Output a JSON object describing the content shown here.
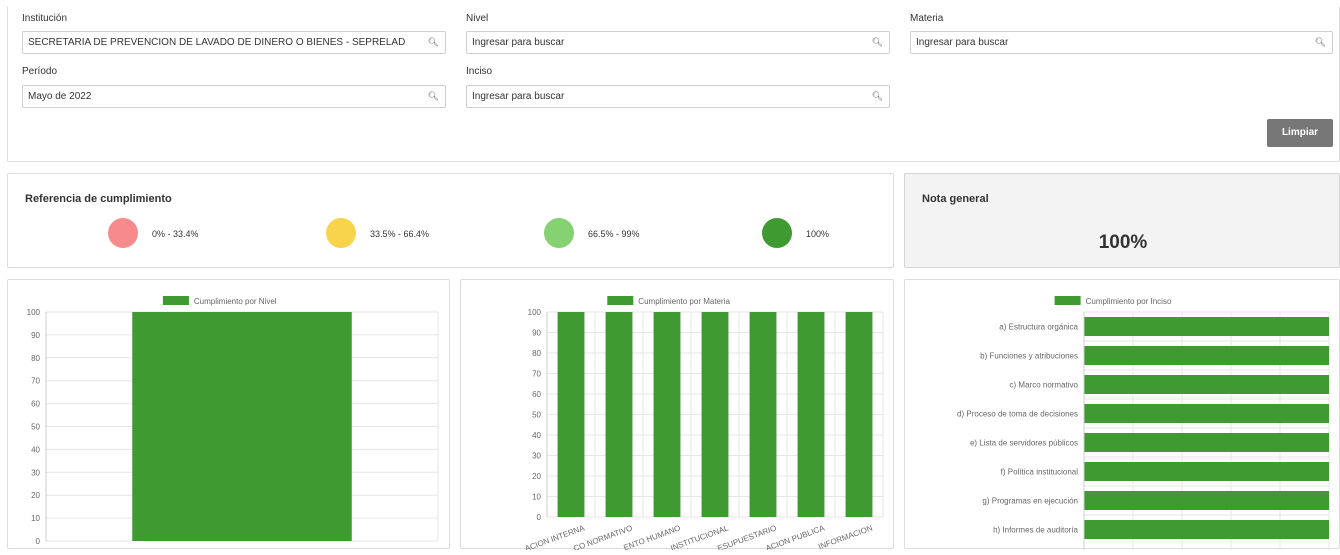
{
  "filters": {
    "institucion": {
      "label": "Institución",
      "value": "SECRETARIA DE PREVENCION DE LAVADO DE DINERO O BIENES - SEPRELAD"
    },
    "nivel": {
      "label": "Nivel",
      "placeholder": "Ingresar para buscar"
    },
    "materia": {
      "label": "Materia",
      "placeholder": "Ingresar para buscar"
    },
    "periodo": {
      "label": "Período",
      "value": "Mayo de 2022"
    },
    "inciso": {
      "label": "Inciso",
      "placeholder": "Ingresar para buscar"
    },
    "clear_label": "Limpiar",
    "search_icon": "search-icon"
  },
  "referencia": {
    "title": "Referencia de cumplimiento",
    "items": [
      {
        "label": "0% - 33.4%",
        "color": "#f78a8a"
      },
      {
        "label": "33.5% - 66.4%",
        "color": "#f7d44c"
      },
      {
        "label": "66.5% - 99%",
        "color": "#86d171"
      },
      {
        "label": "100%",
        "color": "#3e9a31"
      }
    ]
  },
  "nota": {
    "title": "Nota general",
    "value": "100%"
  },
  "colors": {
    "bar": "#3e9a31",
    "grid": "#e6e6e6",
    "axis_text": "#666666"
  },
  "chart_data": [
    {
      "type": "bar",
      "legend": "Cumplimiento por Nivel",
      "categories": [
        ""
      ],
      "values": [
        100
      ],
      "ylim": [
        0,
        100
      ],
      "yticks": [
        "100",
        "90",
        "80",
        "70",
        "60",
        "50",
        "40",
        "30",
        "20",
        "10",
        "0"
      ],
      "grid": true,
      "legend_position": "top"
    },
    {
      "type": "bar",
      "legend": "Cumplimiento por Materia",
      "categories": [
        "ACION INTERNA",
        "CO NORMATIVO",
        "ENTO HUMANO",
        "INSTITUCIONAL",
        "ESUPUESTARIO",
        "ACION PUBLICA",
        "INFORMACION"
      ],
      "values": [
        100,
        100,
        100,
        100,
        100,
        100,
        100
      ],
      "ylim": [
        0,
        100
      ],
      "yticks": [
        "100",
        "90",
        "80",
        "70",
        "60",
        "50",
        "40",
        "30",
        "20",
        "10",
        "0"
      ],
      "grid": true,
      "legend_position": "top"
    },
    {
      "type": "bar",
      "orientation": "horizontal",
      "legend": "Cumplimiento por Inciso",
      "categories": [
        "a) Estructura orgánica",
        "b) Funciones y atribuciones",
        "c) Marco normativo",
        "d) Proceso de toma de decisiones",
        "e) Lista de servidores públicos",
        "f) Política institucional",
        "g) Programas en ejecución",
        "h) Informes de auditoría"
      ],
      "values": [
        100,
        100,
        100,
        100,
        100,
        100,
        100,
        100
      ],
      "xlim": [
        0,
        100
      ],
      "grid": true,
      "legend_position": "top"
    }
  ]
}
